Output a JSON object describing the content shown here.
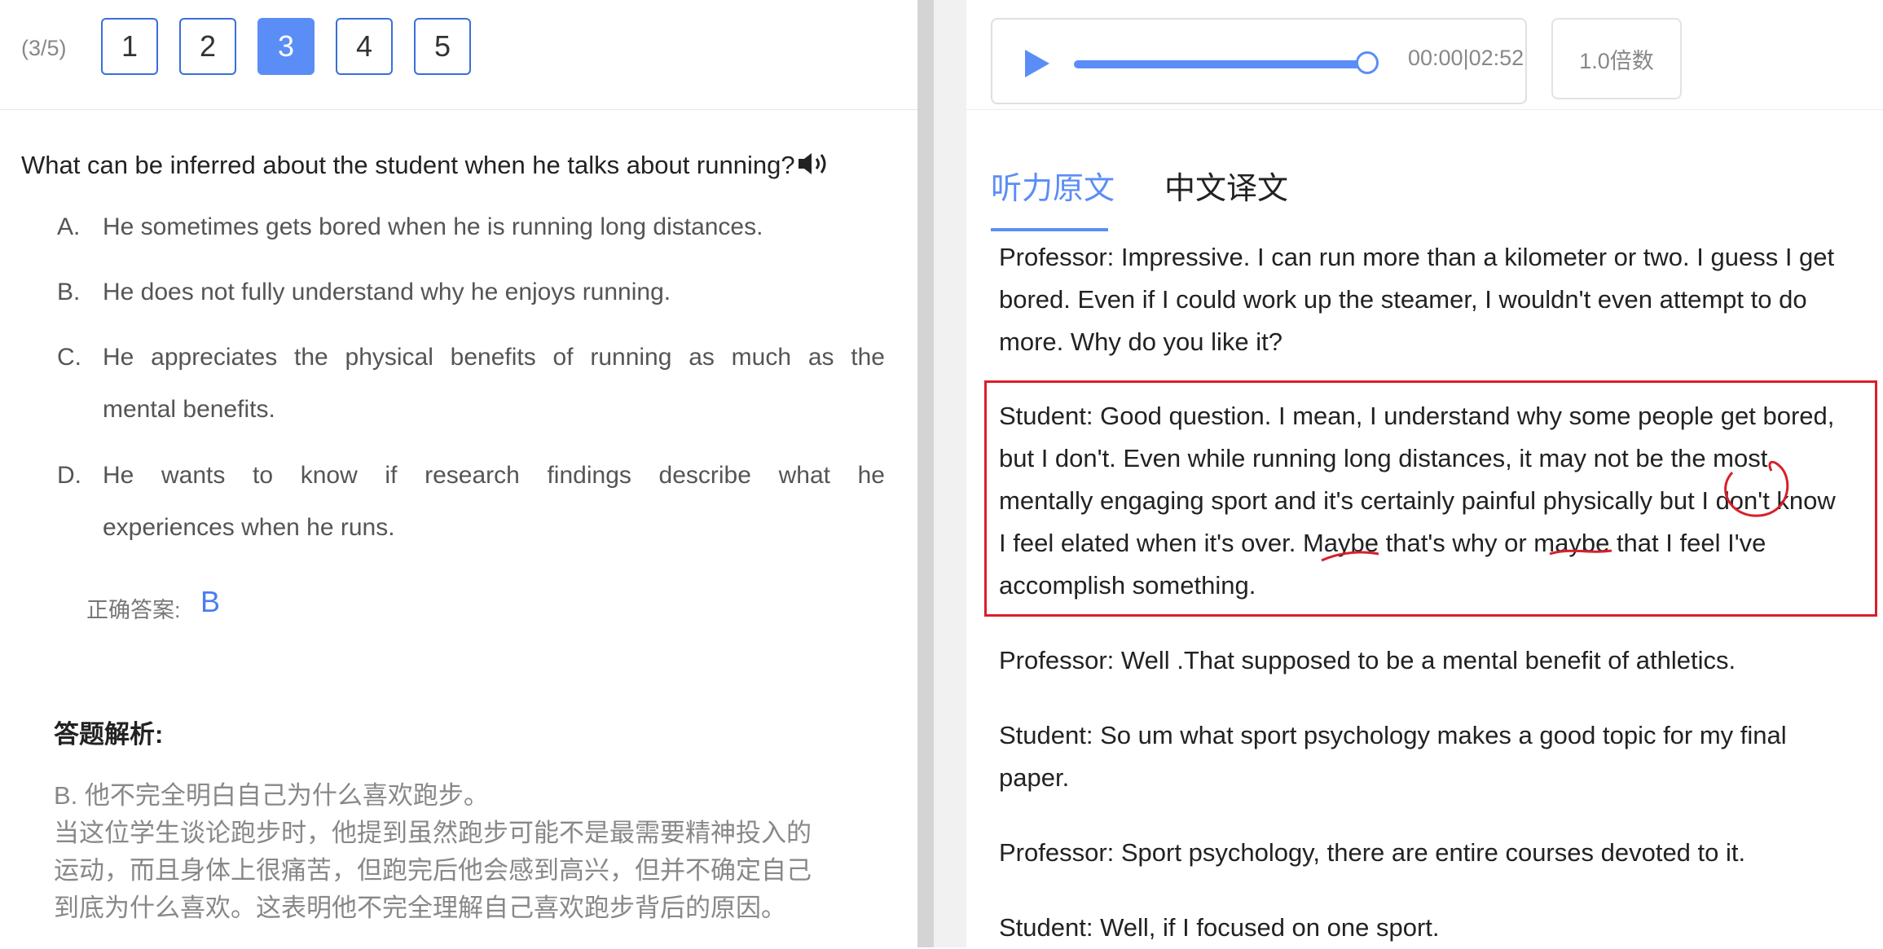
{
  "left": {
    "progress": "(3/5)",
    "question_numbers": [
      "1",
      "2",
      "3",
      "4",
      "5"
    ],
    "active_question": "3",
    "question": "What can be inferred about the student when he talks about running?",
    "options": [
      {
        "letter": "A.",
        "text": "He sometimes gets bored when he is running long distances."
      },
      {
        "letter": "B.",
        "text": "He does not fully understand why he enjoys running."
      },
      {
        "letter": "C.",
        "line1": "He appreciates the physical benefits of running as much as the",
        "line2": "mental benefits."
      },
      {
        "letter": "D.",
        "line1": "He wants to know if research findings describe what he",
        "line2": "experiences when he runs."
      }
    ],
    "answer_label": "正确答案:",
    "answer_value": "B",
    "analysis_title": "答题解析:",
    "analysis_lines": [
      "B. 他不完全明白自己为什么喜欢跑步。",
      "当这位学生谈论跑步时，他提到虽然跑步可能不是最需要精神投入的",
      "运动，而且身体上很痛苦，但跑完后他会感到高兴，但并不确定自己",
      "到底为什么喜欢。这表明他不完全理解自己喜欢跑步背后的原因。"
    ]
  },
  "player": {
    "time": "00:00|02:52",
    "speed_label": "1.0倍数",
    "progress_fraction": 1.0,
    "play_icon": "play-icon"
  },
  "tabs": [
    "听力原文",
    "中文译文"
  ],
  "active_tab": "听力原文",
  "transcript": [
    {
      "lines": [
        "Professor: Impressive. I can run more than a kilometer or two. I guess I get",
        "bored. Even if I could work up the steamer, I wouldn't even attempt to do",
        "more. Why do you like it?"
      ]
    },
    {
      "lines": [
        "Student: Good question. I mean, I understand why some people get bored,",
        "but I don't. Even while running long distances, it may not be the most",
        "mentally engaging sport and it's certainly painful physically but I don't know",
        "I feel elated when it's over. Maybe that's why or maybe that I feel I've",
        "accomplish something."
      ]
    },
    {
      "lines": [
        "Professor:  Well .That supposed to be a mental benefit of athletics."
      ]
    },
    {
      "lines": [
        "Student: So um what sport psychology makes a good topic for my final",
        "paper."
      ]
    },
    {
      "lines": [
        "Professor: Sport psychology, there are entire courses devoted to it."
      ]
    },
    {
      "lines": [
        "Student: Well, if I focused on one sport."
      ]
    }
  ],
  "colors": {
    "accent": "#5b8df6",
    "highlight_box": "#d81f2a"
  }
}
